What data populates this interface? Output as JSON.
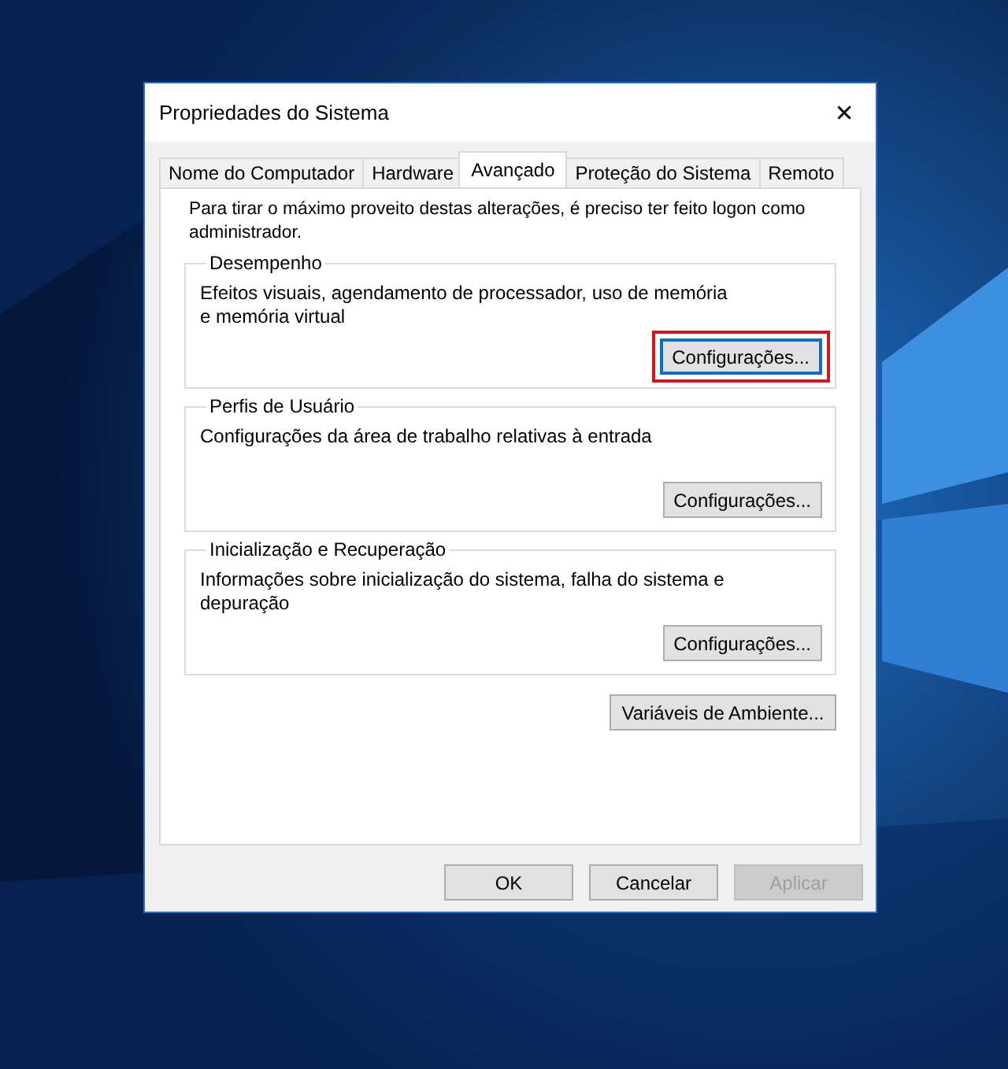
{
  "window": {
    "title": "Propriedades do Sistema",
    "close": "✕"
  },
  "tabs": [
    {
      "label": "Nome do Computador",
      "selected": false
    },
    {
      "label": "Hardware",
      "selected": false
    },
    {
      "label": "Avançado",
      "selected": true
    },
    {
      "label": "Proteção do Sistema",
      "selected": false
    },
    {
      "label": "Remoto",
      "selected": false
    }
  ],
  "intro": "Para tirar o máximo proveito destas alterações, é preciso ter feito logon como administrador.",
  "groups": [
    {
      "title": "Desempenho",
      "description": "Efeitos visuais, agendamento de processador, uso de memória e memória virtual",
      "button": {
        "label": "Configurações...",
        "focused": true,
        "highlighted": true
      }
    },
    {
      "title": "Perfis de Usuário",
      "description": "Configurações da área de trabalho relativas à entrada",
      "button": {
        "label": "Configurações...",
        "focused": false,
        "highlighted": false
      }
    },
    {
      "title": "Inicialização e Recuperação",
      "description": "Informações sobre inicialização do sistema, falha do sistema e depuração",
      "button": {
        "label": "Configurações...",
        "focused": false,
        "highlighted": false
      }
    }
  ],
  "environment_button": {
    "label": "Variáveis de Ambiente..."
  },
  "buttons": [
    {
      "label": "OK",
      "disabled": false
    },
    {
      "label": "Cancelar",
      "disabled": false
    },
    {
      "label": "Aplicar",
      "disabled": true
    }
  ]
}
